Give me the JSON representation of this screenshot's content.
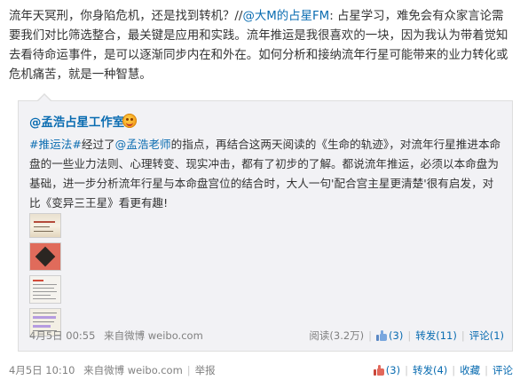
{
  "post": {
    "text_1": "流年天冥刑，你身陷危机，还是找到转机？//",
    "mention_1": "@大M的占星FM",
    "text_2": ": 占星学习，难免会有众家言论需要我们对比筛选整合，最关键是应用和实践。流年推运是我很喜欢的一块，因为我认为带着觉知去看待命运事件，是可以逐渐同步内在和外在。如何分析和接纳流年行星可能带来的业力转化或危机痛苦，就是一种智慧。"
  },
  "quote": {
    "author": "@孟浩占星工作室",
    "topic": "#推运法#",
    "text_1": "经过了",
    "mention": "@孟浩老师",
    "text_2": "的指点，再结合这两天阅读的《生命的轨迹》，对流年行星推进本命盘的一些业力法则、心理转变、现实冲击，都有了初步的了解。都说流年推运，必须以本命盘为基础，进一步分析流年行星与本命盘宫位的结合时，大人一句'配合宫主星更清楚'很有启发，对比《变异三王星》看更有趣!",
    "footer": {
      "time": "4月5日 00:55",
      "source_prefix": "来自",
      "source": "微博 weibo.com",
      "reads": "阅读(3.2万)",
      "likes": "(3)",
      "repost": "转发(11)",
      "comment": "评论(1)"
    }
  },
  "footer": {
    "time": "4月5日 10:10",
    "source_prefix": "来自",
    "source": "微博 weibo.com",
    "report": "举报",
    "likes": "(3)",
    "repost": "转发(4)",
    "favorite": "收藏",
    "comment": "评论"
  },
  "icons": {
    "vip_badge": "vip-smiley-badge",
    "like_blue": "thumbs-up-icon",
    "like_red": "thumbs-up-icon"
  },
  "colors": {
    "link": "#0a6cb1",
    "quote_bg": "#f2f2f5",
    "muted": "#808080"
  }
}
